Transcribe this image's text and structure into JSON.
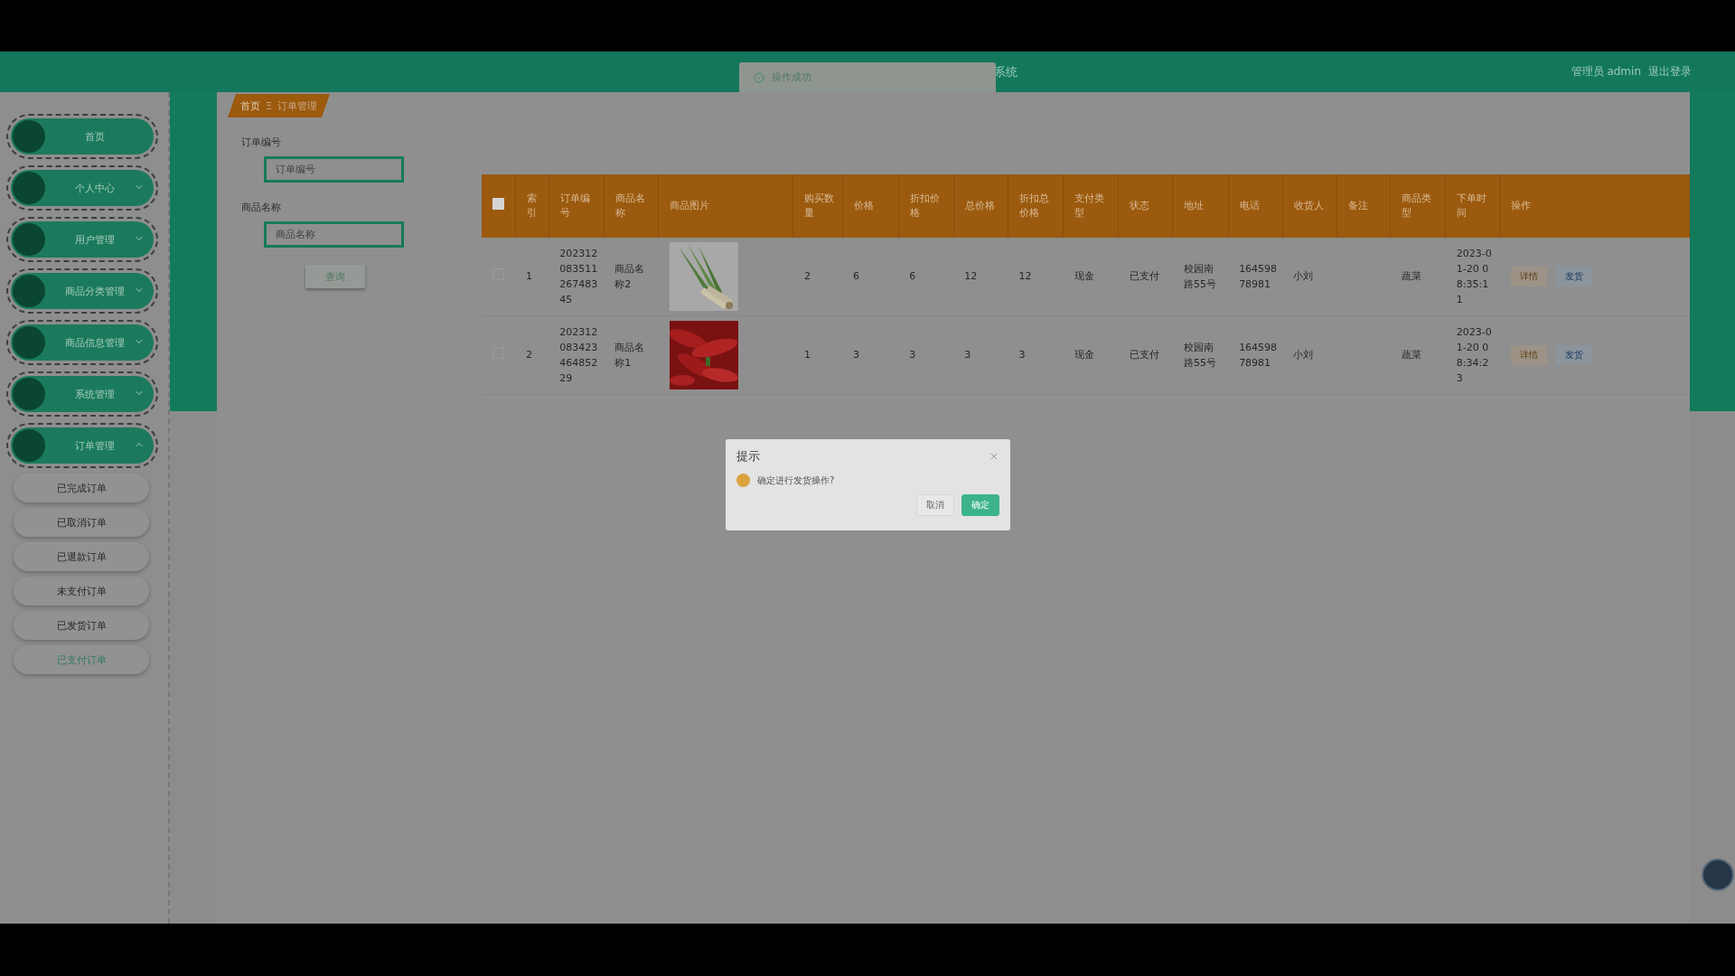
{
  "header": {
    "title": "系统",
    "user_label": "管理员 admin",
    "logout": "退出登录"
  },
  "toast": {
    "text": "操作成功"
  },
  "sidebar": {
    "items": [
      {
        "label": "首页",
        "kind": "link"
      },
      {
        "label": "个人中心",
        "kind": "menu",
        "expanded": false
      },
      {
        "label": "用户管理",
        "kind": "menu",
        "expanded": false
      },
      {
        "label": "商品分类管理",
        "kind": "menu",
        "expanded": false
      },
      {
        "label": "商品信息管理",
        "kind": "menu",
        "expanded": false
      },
      {
        "label": "系统管理",
        "kind": "menu",
        "expanded": false
      },
      {
        "label": "订单管理",
        "kind": "menu",
        "expanded": true,
        "children": [
          {
            "label": "已完成订单",
            "selected": false
          },
          {
            "label": "已取消订单",
            "selected": false
          },
          {
            "label": "已退款订单",
            "selected": false
          },
          {
            "label": "未支付订单",
            "selected": false
          },
          {
            "label": "已发货订单",
            "selected": false
          },
          {
            "label": "已支付订单",
            "selected": true
          }
        ]
      }
    ]
  },
  "breadcrumb": {
    "items": [
      "首页",
      "订单管理"
    ],
    "separator": "Ξ"
  },
  "search": {
    "fields": [
      {
        "label": "订单编号",
        "placeholder": "订单编号"
      },
      {
        "label": "商品名称",
        "placeholder": "商品名称"
      }
    ],
    "button": "查询"
  },
  "table": {
    "header_checkbox": {
      "checked": false
    },
    "columns": [
      "索引",
      "订单编号",
      "商品名称",
      "商品图片",
      "购买数量",
      "价格",
      "折扣价格",
      "总价格",
      "折扣总价格",
      "支付类型",
      "状态",
      "地址",
      "电话",
      "收货人",
      "备注",
      "商品类型",
      "下单时间",
      "操作"
    ],
    "rows": [
      {
        "checked": false,
        "index": "1",
        "order_no": "20231208351126748345",
        "product_name": "商品名称2",
        "quantity": "2",
        "price": "6",
        "discount_price": "6",
        "total": "12",
        "discount_total": "12",
        "payment": "现金",
        "status": "已支付",
        "address": "校园南路55号",
        "phone": "16459878981",
        "receiver": "小刘",
        "product_type": "蔬菜",
        "time": "2023-01-20 08:35:11",
        "actions": [
          {
            "label": "详情",
            "kind": "warning"
          },
          {
            "label": "发货",
            "kind": "primary"
          }
        ]
      },
      {
        "checked": false,
        "index": "2",
        "order_no": "20231208342346485229",
        "product_name": "商品名称1",
        "quantity": "1",
        "price": "3",
        "discount_price": "3",
        "total": "3",
        "discount_total": "3",
        "payment": "现金",
        "status": "已支付",
        "address": "校园南路55号",
        "phone": "16459878981",
        "receiver": "小刘",
        "product_type": "蔬菜",
        "time": "2023-01-20 08:34:23",
        "actions": [
          {
            "label": "详情",
            "kind": "warning"
          },
          {
            "label": "发货",
            "kind": "primary"
          }
        ]
      }
    ]
  },
  "dialog": {
    "title": "提示",
    "message": "确定进行发货操作?",
    "buttons": [
      {
        "label": "取消",
        "kind": "default"
      },
      {
        "label": "确定",
        "kind": "primary"
      }
    ]
  }
}
